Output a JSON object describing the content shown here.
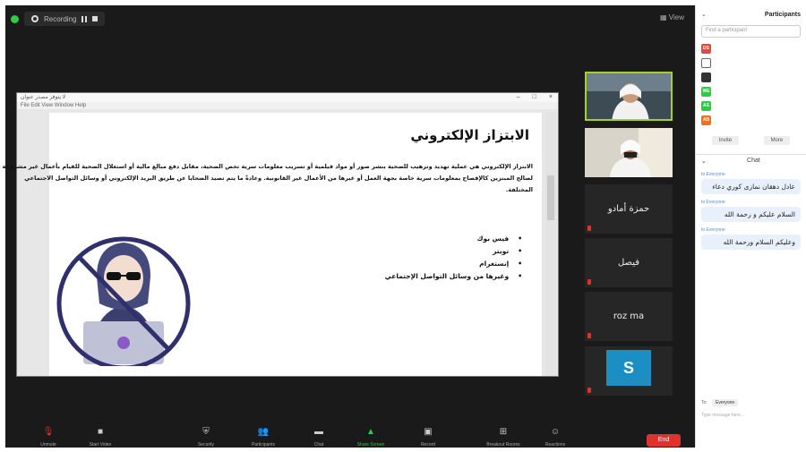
{
  "topbar": {
    "recording_label": "Recording",
    "view_label": "View"
  },
  "shared_window": {
    "title": "لا يتوفر مصدر عنوان",
    "menu": "File  Edit  View  Window  Help",
    "slide_title": "الابتزاز الإلكتروني",
    "paragraph": "الابتزاز الإلكتروني هي عملية تهديد وترهيب للضحية بنشر صور أو مواد فيلمية أو تسريب معلومات سرية تخص الضحية، مقابل دفع مبالغ مالية أو استغلال الضحية للقيام بأعمال غير مشروعة لصالح المبتزين كالإفصاح بمعلومات سرية خاصة بجهة العمل أو غيرها من الأعمال غير القانونية. وعادةً ما يتم تصيد الضحايا عن طريق البريد الإلكتروني أو وسائل التواصل الاجتماعي المختلفة.",
    "bullets": [
      "فيس بوك",
      "تويتر",
      "إنستغرام",
      "وغيرها من وسائل التواصل الإجتماعي"
    ]
  },
  "tiles": [
    {
      "label": "",
      "type": "video",
      "speaking": true
    },
    {
      "label": "",
      "type": "video",
      "speaking": false
    },
    {
      "name": "حمزة أمادو",
      "type": "name"
    },
    {
      "name": "فيصل",
      "type": "name"
    },
    {
      "name": "roz ma",
      "type": "name"
    },
    {
      "initial": "S",
      "label": "",
      "type": "initial"
    }
  ],
  "toolbar": {
    "items": [
      {
        "icon": "mic-icon",
        "label": "Unmute"
      },
      {
        "icon": "video-icon",
        "label": "Start Video"
      },
      {
        "icon": "security-icon",
        "label": "Security"
      },
      {
        "icon": "participants-icon",
        "label": "Participants"
      },
      {
        "icon": "chat-icon",
        "label": "Chat"
      },
      {
        "icon": "share-screen-icon",
        "label": "Share Screen"
      },
      {
        "icon": "record-icon",
        "label": "Record"
      },
      {
        "icon": "breakout-icon",
        "label": "Breakout Rooms"
      },
      {
        "icon": "reactions-icon",
        "label": "Reactions"
      }
    ],
    "end_label": "End"
  },
  "panel": {
    "title": "Participants",
    "search_placeholder": "Find a participant",
    "participants": [
      {
        "initials": "DS",
        "color": "#e14b3c",
        "name": ""
      },
      {
        "initials": "",
        "color": "#666666",
        "name": ""
      },
      {
        "initials": "",
        "color": "#333333",
        "name": ""
      },
      {
        "initials": "WE",
        "color": "#2ecc40",
        "name": ""
      },
      {
        "initials": "AS",
        "color": "#2ecc40",
        "name": ""
      },
      {
        "initials": "AB",
        "color": "#f2711c",
        "name": ""
      }
    ],
    "invite_label": "Invite",
    "more_label": "More",
    "chat_title": "Chat",
    "messages": [
      {
        "meta": "to Everyone",
        "text": "عادل دهقان نمازی كوري دعاء"
      },
      {
        "meta": "to Everyone",
        "text": "السلام عليكم و رحمة الله"
      },
      {
        "meta": "to Everyone",
        "text": "وعليكم السلام ورحمة الله"
      }
    ],
    "to_label": "To:",
    "to_value": "Everyone",
    "type_placeholder": "Type message here..."
  }
}
